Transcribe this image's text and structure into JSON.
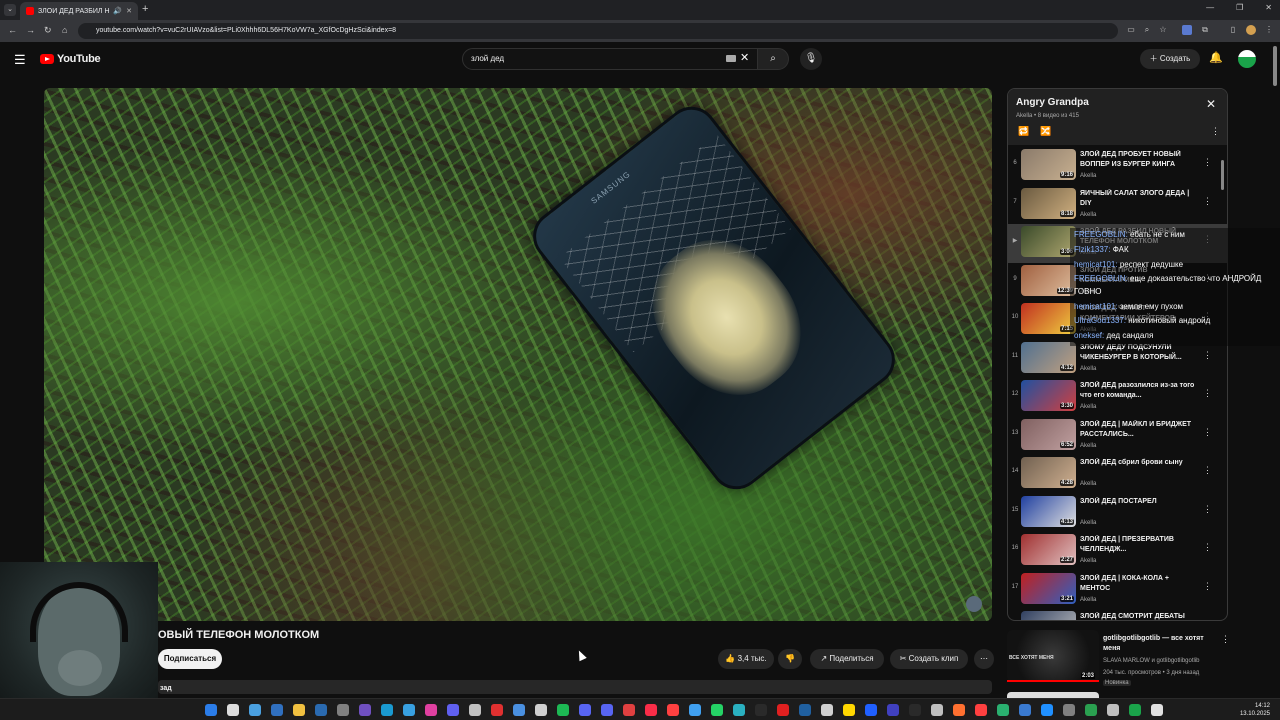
{
  "browser": {
    "tab_title": "ЗЛОЙ ДЕД РАЗБИЛ НОВЫ",
    "url": "youtube.com/watch?v=vuC2rUIAVzo&list=PLi0Xhhh6DL56H7KoVW7a_XGfOcDgHzSci&index=8"
  },
  "header": {
    "logo": "YouTube",
    "search_value": "злой дед",
    "create_label": "Создать"
  },
  "video": {
    "phone_brand": "SAMSUNG",
    "title": "ОВЫЙ ТЕЛЕФОН МОЛОТКОМ",
    "subscribe": "Подписаться",
    "likes": "3,4 тыс.",
    "share": "Поделиться",
    "clip": "Создать клип",
    "description_snippet": "зад"
  },
  "playlist": {
    "title": "Angry Grandpa",
    "subtitle": "Akella • 8 видео из 415",
    "items": [
      {
        "index": "6",
        "title": "ЗЛОЙ ДЕД ПРОБУЕТ НОВЫЙ ВОППЕР ИЗ БУРГЕР КИНГА",
        "channel": "Akella",
        "duration": "9:16",
        "current": false,
        "c1": "#8a7a6a",
        "c2": "#c8b090"
      },
      {
        "index": "7",
        "title": "ЯИЧНЫЙ САЛАТ ЗЛОГО ДЕДА | DIY",
        "channel": "Akella",
        "duration": "8:18",
        "current": false,
        "c1": "#6a5a40",
        "c2": "#d0b080"
      },
      {
        "index": "▶",
        "title": "ЗЛОЙ ДЕД РАЗБИЛ НОВЫЙ ТЕЛЕФОН МОЛОТКОМ",
        "channel": "Akella",
        "duration": "3:06",
        "current": true,
        "c1": "#3a4a2a",
        "c2": "#b0a870"
      },
      {
        "index": "9",
        "title": "ЗЛОЙ ДЕД ПРОТИВ КОММЕНТАРИЕВ",
        "channel": "Akella",
        "duration": "12:39",
        "current": false,
        "c1": "#a06040",
        "c2": "#e0c0a0"
      },
      {
        "index": "10",
        "title": "ЗЛОЙ ДЕД ЧИТАЕТ КОММЕНТАРИИ ХЕЙТЕРОВ",
        "channel": "Akella",
        "duration": "7:15",
        "current": false,
        "c1": "#c03020",
        "c2": "#f0d040"
      },
      {
        "index": "11",
        "title": "ЗЛОМУ ДЕДУ ПОДСУНУЛИ ЧИКЕНБУРГЕР В КОТОРЫЙ...",
        "channel": "Akella",
        "duration": "4:12",
        "current": false,
        "c1": "#507090",
        "c2": "#c0a080"
      },
      {
        "index": "12",
        "title": "ЗЛОЙ ДЕД разозлился из-за того что его команда...",
        "channel": "Akella",
        "duration": "3:30",
        "current": false,
        "c1": "#2050a0",
        "c2": "#d04040"
      },
      {
        "index": "13",
        "title": "ЗЛОЙ ДЕД | МАЙКЛ И БРИДЖЕТ РАССТАЛИСЬ...",
        "channel": "Akella",
        "duration": "6:52",
        "current": false,
        "c1": "#806060",
        "c2": "#c0a0a0"
      },
      {
        "index": "14",
        "title": "ЗЛОЙ ДЕД сбрил брови сыну",
        "channel": "Akella",
        "duration": "4:28",
        "current": false,
        "c1": "#706050",
        "c2": "#d0b090"
      },
      {
        "index": "15",
        "title": "ЗЛОЙ ДЕД ПОСТАРЕЛ",
        "channel": "Akella",
        "duration": "4:13",
        "current": false,
        "c1": "#2040a0",
        "c2": "#e0e0e0"
      },
      {
        "index": "16",
        "title": "ЗЛОЙ ДЕД | ПРЕЗЕРВАТИВ ЧЕЛЛЕНДЖ...",
        "channel": "Akella",
        "duration": "2:27",
        "current": false,
        "c1": "#a03030",
        "c2": "#e0c0c0"
      },
      {
        "index": "17",
        "title": "ЗЛОЙ ДЕД | КОКА-КОЛА + МЕНТОС",
        "channel": "Akella",
        "duration": "3:21",
        "current": false,
        "c1": "#c02020",
        "c2": "#3060c0"
      },
      {
        "index": "18",
        "title": "ЗЛОЙ ДЕД СМОТРИТ ДЕБАТЫ КЛИНТОН И",
        "channel": "Akella",
        "duration": "",
        "current": false,
        "c1": "#304060",
        "c2": "#c0c0c0"
      }
    ]
  },
  "chat": [
    {
      "user": "FREEGOBLIN:",
      "msg": "ебать не с ним"
    },
    {
      "user": "Flzik1337:",
      "msg": "ФАК"
    },
    {
      "user": "hemicat101:",
      "msg": "респект дедушке"
    },
    {
      "user": "FREEGOBLIN:",
      "msg": "еще доказательство что АНДРОЙД"
    },
    {
      "user": "",
      "msg": "ГОВНО"
    },
    {
      "user": "hemicat101:",
      "msg": "земля ему пухом"
    },
    {
      "user": "UltraGod1337:",
      "msg": "никотиновый андройд"
    },
    {
      "user": "oneksef:",
      "msg": "дед сандаля"
    }
  ],
  "recommended": {
    "title": "gotlibgotlibgotlib — все хотят меня",
    "channel": "SLAVA MARLOW и gotlibgotlibgotlib",
    "meta": "204 тыс. просмотров • 3 дня назад",
    "badge": "Новинка",
    "duration": "2:03",
    "thumb_text": "ВСЕ ХОТЯТ МЕНЯ"
  },
  "taskbar": {
    "time": "14:12",
    "date": "13.10.2025",
    "icons": [
      "#2b7de9",
      "#dddddd",
      "#4aa0e0",
      "#3070c0",
      "#f0c040",
      "#2a6ab0",
      "#808080",
      "#7050c0",
      "#1a9ad0",
      "#38a0e0",
      "#e040a0",
      "#6060f0",
      "#c0c0c0",
      "#e03030",
      "#4a90e0",
      "#d0d0d0",
      "#1db954",
      "#5865f2",
      "#5865f2",
      "#e04040",
      "#fa2d48",
      "#ff4040",
      "#40a0f0",
      "#25d366",
      "#2ab0c0",
      "#2a2a2a",
      "#e02020",
      "#2060a0",
      "#d0d0d0",
      "#ffd700",
      "#2060ff",
      "#4040c0",
      "#2a2a2a",
      "#c0c0c0",
      "#ff7030",
      "#ff4040",
      "#2ab070",
      "#3a7ad0",
      "#2090ff",
      "#808080",
      "#2aa050",
      "#c0c0c0",
      "#1aa34a",
      "#e0e0e0"
    ]
  },
  "colors": {
    "accent": "#ff0000",
    "link": "#8ab4ff"
  }
}
